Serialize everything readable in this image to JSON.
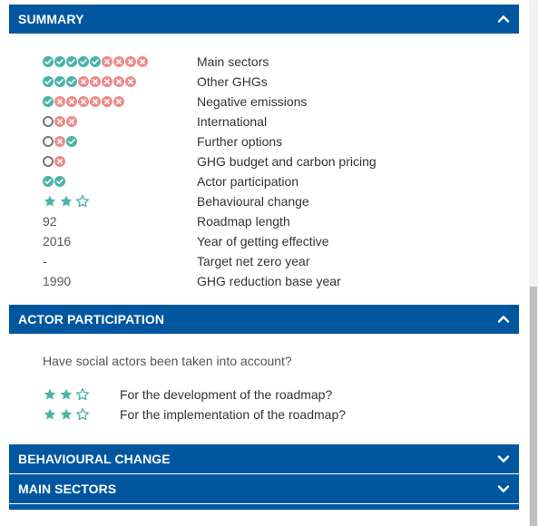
{
  "colors": {
    "header_bg": "#0057a0",
    "ok": "#4ab3a6",
    "no": "#ef8a8a",
    "star": "#4ab3a6"
  },
  "summary": {
    "title": "SUMMARY",
    "rows": [
      {
        "indicator": [
          "ok",
          "ok",
          "ok",
          "ok",
          "ok",
          "no",
          "no",
          "no",
          "no"
        ],
        "label": "Main sectors"
      },
      {
        "indicator": [
          "ok",
          "ok",
          "ok",
          "no",
          "no",
          "no",
          "no",
          "no"
        ],
        "label": "Other GHGs"
      },
      {
        "indicator": [
          "ok",
          "no",
          "no",
          "no",
          "no",
          "no",
          "no"
        ],
        "label": "Negative emissions"
      },
      {
        "indicator": [
          "na",
          "no",
          "no"
        ],
        "label": "International"
      },
      {
        "indicator": [
          "na",
          "no",
          "ok"
        ],
        "label": "Further options"
      },
      {
        "indicator": [
          "na",
          "no"
        ],
        "label": "GHG budget and carbon pricing"
      },
      {
        "indicator": [
          "ok",
          "ok"
        ],
        "label": "Actor participation"
      },
      {
        "stars": 2,
        "stars_max": 3,
        "label": "Behavioural change"
      },
      {
        "value": "92",
        "label": "Roadmap length"
      },
      {
        "value": "2016",
        "label": "Year of getting effective"
      },
      {
        "value": "-",
        "label": "Target net zero year"
      },
      {
        "value": "1990",
        "label": "GHG reduction base year"
      }
    ]
  },
  "actor": {
    "title": "ACTOR PARTICIPATION",
    "question": "Have social actors been taken into account?",
    "rows": [
      {
        "stars": 2,
        "stars_max": 3,
        "label": "For the development of the roadmap?"
      },
      {
        "stars": 2,
        "stars_max": 3,
        "label": "For the implementation of the roadmap?"
      }
    ]
  },
  "behavioural": {
    "title": "BEHAVIOURAL CHANGE"
  },
  "main_sectors": {
    "title": "MAIN SECTORS"
  },
  "icons": {
    "expanded": "chevron-up-icon",
    "collapsed": "chevron-down-icon",
    "ok": "check-icon",
    "no": "cross-icon",
    "na": "empty-circle-icon",
    "star": "star-icon"
  }
}
